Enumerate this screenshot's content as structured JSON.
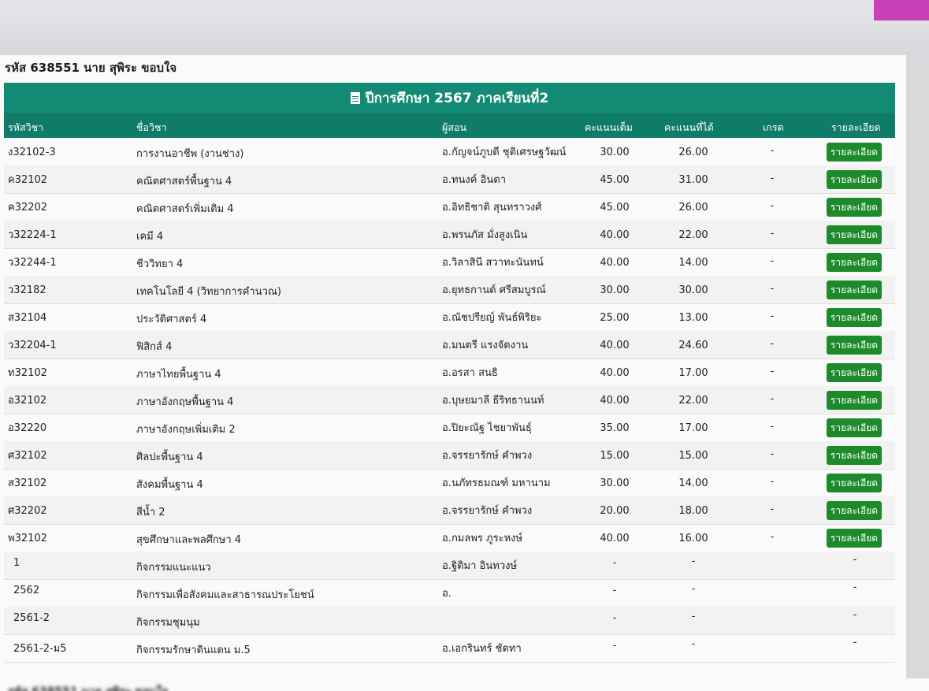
{
  "student_info": "รหัส 638551 นาย สุพิระ ขอบใจ",
  "term_title": "ปีการศึกษา 2567 ภาคเรียนที่2",
  "columns": {
    "code": "รหัสวิชา",
    "name": "ชื่อวิชา",
    "teacher": "ผู้สอน",
    "full": "คะแนนเต็ม",
    "score": "คะแนนที่ได้",
    "grade": "เกรด",
    "detail": "รายละเอียด"
  },
  "rows": [
    {
      "code": "ง32102-3",
      "name": "การงานอาชีพ (งานช่าง)",
      "teacher": "อ.กัญจน์ภูบดี ชุติเศรษฐวัฒน์",
      "full": "30.00",
      "score": "26.00",
      "grade": "-",
      "detail": "รายละเอียด"
    },
    {
      "code": "ค32102",
      "name": "คณิตศาสตร์พื้นฐาน 4",
      "teacher": "อ.ทนงค์ อินตา",
      "full": "45.00",
      "score": "31.00",
      "grade": "-",
      "detail": "รายละเอียด"
    },
    {
      "code": "ค32202",
      "name": "คณิตศาสตร์เพิ่มเติม 4",
      "teacher": "อ.อิทธิชาติ สุนทราวงศ์",
      "full": "45.00",
      "score": "26.00",
      "grade": "-",
      "detail": "รายละเอียด"
    },
    {
      "code": "ว32224-1",
      "name": "เคมี 4",
      "teacher": "อ.พรนภัส มั่งสูงเนิน",
      "full": "40.00",
      "score": "22.00",
      "grade": "-",
      "detail": "รายละเอียด"
    },
    {
      "code": "ว32244-1",
      "name": "ชีววิทยา 4",
      "teacher": "อ.วิลาสินี สวาทะนันทน์",
      "full": "40.00",
      "score": "14.00",
      "grade": "-",
      "detail": "รายละเอียด"
    },
    {
      "code": "ว32182",
      "name": "เทคโนโลยี 4 (วิทยาการคำนวณ)",
      "teacher": "อ.ยุทธกานต์ ศรีสมบูรณ์",
      "full": "30.00",
      "score": "30.00",
      "grade": "-",
      "detail": "รายละเอียด"
    },
    {
      "code": "ส32104",
      "name": "ประวัติศาสตร์ 4",
      "teacher": "อ.ณัชปรียญ์ พันธ์พิริยะ",
      "full": "25.00",
      "score": "13.00",
      "grade": "-",
      "detail": "รายละเอียด"
    },
    {
      "code": "ว32204-1",
      "name": "ฟิสิกส์ 4",
      "teacher": "อ.มนตรี แรงจัดงาน",
      "full": "40.00",
      "score": "24.60",
      "grade": "-",
      "detail": "รายละเอียด"
    },
    {
      "code": "ท32102",
      "name": "ภาษาไทยพื้นฐาน 4",
      "teacher": "อ.อรสา สนธิ",
      "full": "40.00",
      "score": "17.00",
      "grade": "-",
      "detail": "รายละเอียด"
    },
    {
      "code": "อ32102",
      "name": "ภาษาอังกฤษพื้นฐาน 4",
      "teacher": "อ.บุษยมาลี ธีริทธานนท์",
      "full": "40.00",
      "score": "22.00",
      "grade": "-",
      "detail": "รายละเอียด"
    },
    {
      "code": "อ32220",
      "name": "ภาษาอังกฤษเพิ่มเติม 2",
      "teacher": "อ.ปิยะณัฐ ไชยาพันธุ์",
      "full": "35.00",
      "score": "17.00",
      "grade": "-",
      "detail": "รายละเอียด"
    },
    {
      "code": "ศ32102",
      "name": "ศิลปะพื้นฐาน 4",
      "teacher": "อ.จรรยารักษ์ คำพวง",
      "full": "15.00",
      "score": "15.00",
      "grade": "-",
      "detail": "รายละเอียด"
    },
    {
      "code": "ส32102",
      "name": "สังคมพื้นฐาน 4",
      "teacher": "อ.นภัทรธมณฑ์ มหานาม",
      "full": "30.00",
      "score": "14.00",
      "grade": "-",
      "detail": "รายละเอียด"
    },
    {
      "code": "ศ32202",
      "name": "สีน้ำ 2",
      "teacher": "อ.จรรยารักษ์ คำพวง",
      "full": "20.00",
      "score": "18.00",
      "grade": "-",
      "detail": "รายละเอียด"
    },
    {
      "code": "พ32102",
      "name": "สุขศึกษาและพลศึกษา 4",
      "teacher": "อ.กมลพร ภูระหงษ์",
      "full": "40.00",
      "score": "16.00",
      "grade": "-",
      "detail": "รายละเอียด"
    }
  ],
  "activities": [
    {
      "code": "1",
      "name": "กิจกรรมแนะแนว",
      "teacher": "อ.ฐิติมา อินทวงษ์",
      "full": "-",
      "score": "-",
      "grade": "-"
    },
    {
      "code": "2562",
      "name": "กิจกรรมเพื่อสังคมและสาธารณประโยชน์",
      "teacher": "อ.",
      "full": "-",
      "score": "-",
      "grade": "-"
    },
    {
      "code": "2561-2",
      "name": "กิจกรรมชุมนุม",
      "teacher": "",
      "full": "-",
      "score": "-",
      "grade": "-"
    },
    {
      "code": "2561-2-ม5",
      "name": "กิจกรรมรักษาดินแดน ม.5",
      "teacher": "อ.เอกรินทร์ ชัดทา",
      "full": "-",
      "score": "-",
      "grade": "-"
    }
  ],
  "colors": {
    "header_teal": "#138a73",
    "button_green": "#1d8a2b"
  },
  "icons": {
    "term_icon": "document-icon"
  }
}
